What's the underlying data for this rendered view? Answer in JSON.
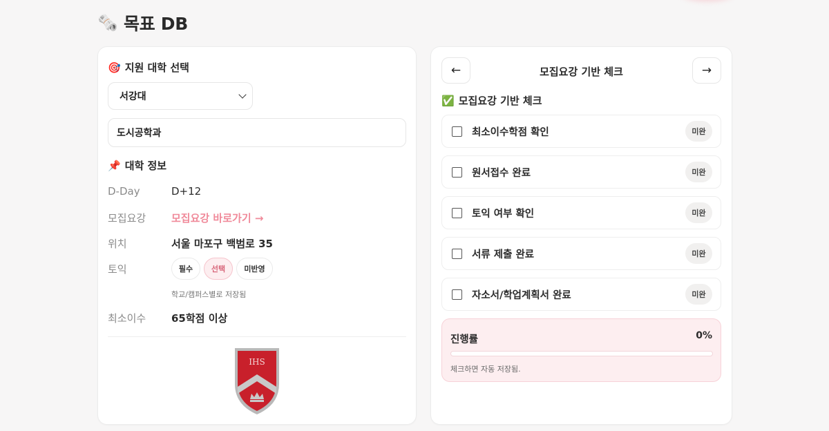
{
  "page": {
    "title_icon": "newspaper-emoji",
    "title_icon_glyph": "🗞️",
    "title": "목표 DB"
  },
  "left": {
    "select_section": {
      "icon_glyph": "🎯",
      "title": "지원 대학 선택"
    },
    "university_select": {
      "value": "서강대"
    },
    "department_field": {
      "value": "도시공학과"
    },
    "info_section": {
      "icon_glyph": "📌",
      "title": "대학 정보"
    },
    "info": {
      "dday": {
        "label": "D-Day",
        "value": "D+12"
      },
      "guideline": {
        "label": "모집요강",
        "value": "모집요강 바로가기 →"
      },
      "location": {
        "label": "위치",
        "value": "서울 마포구 백범로 35"
      },
      "toeic": {
        "label": "토익",
        "options": [
          "필수",
          "선택",
          "미반영"
        ],
        "selected": "선택",
        "hint": "학교/캠퍼스별로 저장됨"
      },
      "min_credits": {
        "label": "최소이수",
        "value": "65학점 이상"
      }
    },
    "emblem": {
      "text": "IHS",
      "colors": {
        "red": "#c8202b",
        "silver": "#b9b9b9"
      }
    }
  },
  "right": {
    "nav": {
      "prev": "←",
      "title": "모집요강 기반 체크",
      "next": "→"
    },
    "checklist_section": {
      "icon_glyph": "✅",
      "title": "모집요강 기반 체크"
    },
    "checklist": [
      {
        "label": "최소이수학점 확인",
        "status": "미완",
        "checked": false
      },
      {
        "label": "원서접수 완료",
        "status": "미완",
        "checked": false
      },
      {
        "label": "토익 여부 확인",
        "status": "미완",
        "checked": false
      },
      {
        "label": "서류 제출 완료",
        "status": "미완",
        "checked": false
      },
      {
        "label": "자소서/학업계획서 완료",
        "status": "미완",
        "checked": false
      }
    ],
    "progress": {
      "label": "진행률",
      "percent_text": "0%",
      "value": 0,
      "note": "체크하면 자동 저장됨."
    }
  },
  "colors": {
    "accent": "#f08a9a",
    "accent_bg": "#fdeef0",
    "background": "#f7f6f6"
  }
}
